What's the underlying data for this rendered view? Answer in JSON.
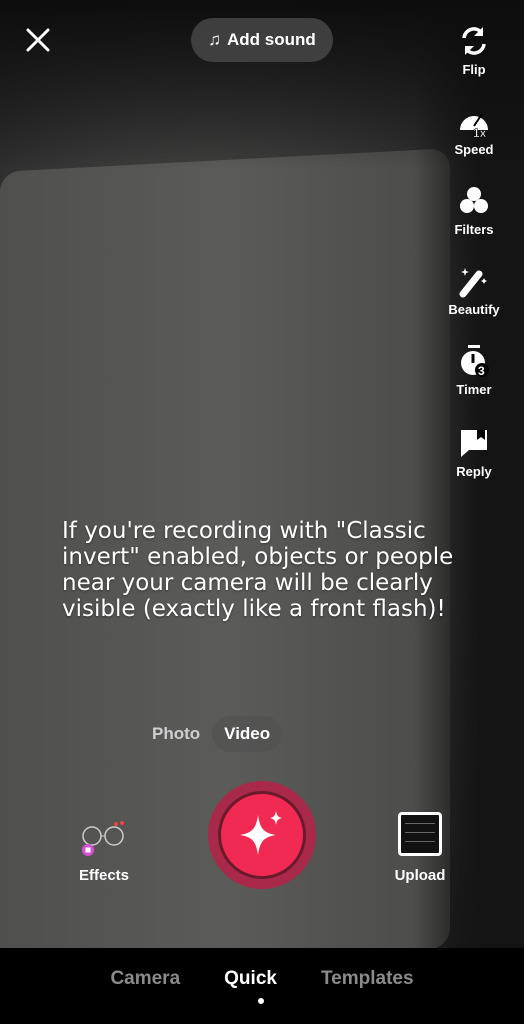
{
  "top": {
    "add_sound": "Add sound"
  },
  "sidebar": {
    "items": [
      {
        "label": "Flip",
        "icon": "flip-icon"
      },
      {
        "label": "Speed",
        "icon": "speed-icon",
        "badge": "1x"
      },
      {
        "label": "Filters",
        "icon": "filters-icon"
      },
      {
        "label": "Beautify",
        "icon": "beautify-icon"
      },
      {
        "label": "Timer",
        "icon": "timer-icon",
        "badge": "3"
      },
      {
        "label": "Reply",
        "icon": "reply-icon"
      }
    ]
  },
  "overlay_text": "If you're recording with \"Classic invert\" enabled, objects or people near your camera will be clearly visible (exactly like a front flash)!",
  "modes": {
    "photo": "Photo",
    "video": "Video",
    "selected": "Video"
  },
  "bottom": {
    "effects": "Effects",
    "upload": "Upload"
  },
  "nav": {
    "tabs": [
      "Camera",
      "Quick",
      "Templates"
    ],
    "selected": "Quick"
  },
  "colors": {
    "record": "#f02a53",
    "effects_badge": "#d94fd6"
  }
}
